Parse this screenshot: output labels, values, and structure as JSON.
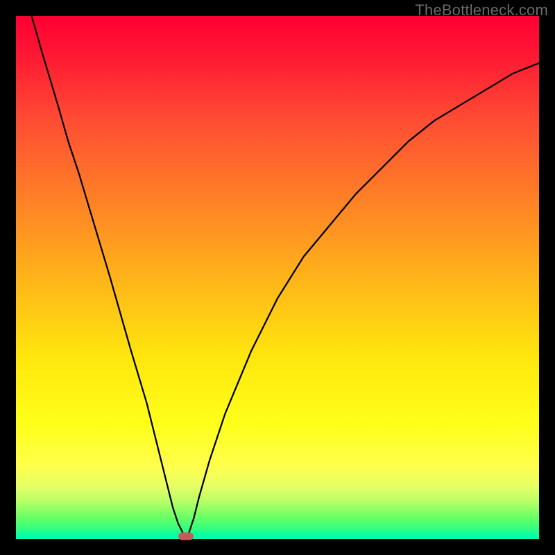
{
  "watermark": "TheBottleneck.com",
  "chart_data": {
    "type": "line",
    "title": "",
    "xlabel": "",
    "ylabel": "",
    "xlim": [
      0,
      100
    ],
    "ylim": [
      0,
      100
    ],
    "x": [
      3,
      5,
      8,
      10,
      12,
      15,
      18,
      20,
      22,
      25,
      27,
      29,
      30,
      31,
      32,
      32.5,
      33,
      34,
      35,
      37,
      40,
      45,
      50,
      55,
      60,
      65,
      70,
      75,
      80,
      85,
      90,
      95,
      100
    ],
    "y": [
      100,
      93,
      83,
      76,
      70,
      60,
      50,
      43,
      36,
      26,
      18,
      10,
      6,
      3,
      1,
      0.5,
      1,
      4,
      8,
      15,
      24,
      36,
      46,
      54,
      60,
      66,
      71,
      76,
      80,
      83,
      86,
      89,
      91
    ],
    "marker": {
      "x": 32.5,
      "y": 0.5
    },
    "legend": false,
    "grid": false,
    "background_gradient": [
      "#ff0033",
      "#ffff1a",
      "#00ffaa"
    ]
  },
  "colors": {
    "curve": "#000000",
    "marker": "#c95a5a",
    "frame": "#000000"
  }
}
